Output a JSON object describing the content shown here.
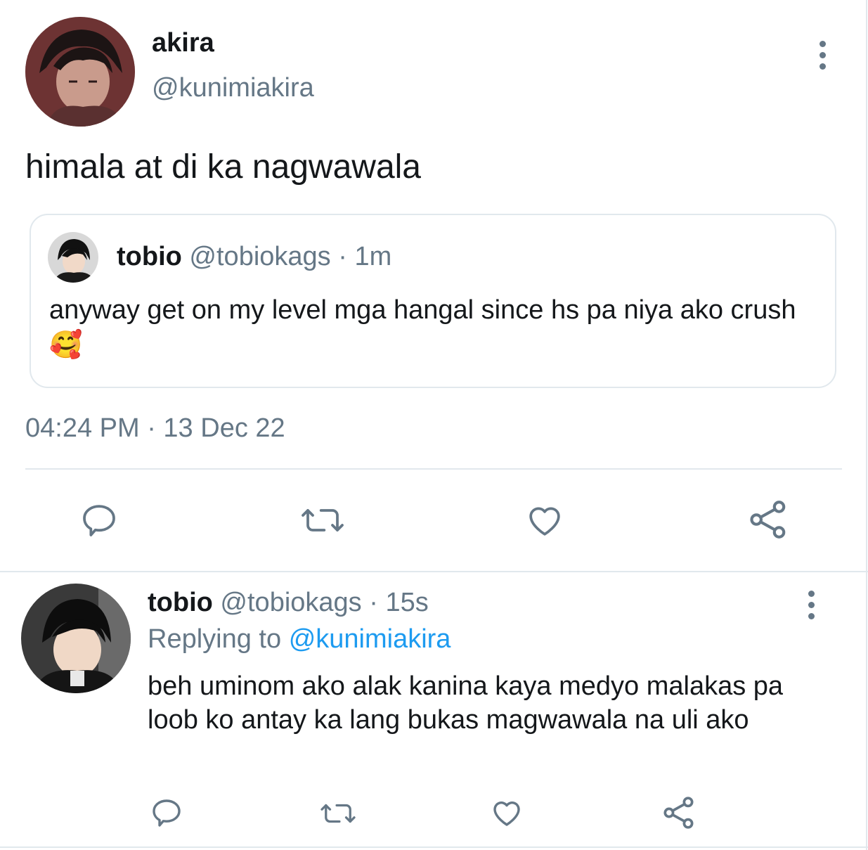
{
  "main_tweet": {
    "author_name": "akira",
    "author_handle": "@kunimiakira",
    "text": "himala at di ka nagwawala",
    "quoted": {
      "author_name": "tobio",
      "author_handle": "@tobiokags",
      "time": "· 1m",
      "text": "anyway get on my level mga hangal since hs pa niya ako crush",
      "emoji": "🥰"
    },
    "timestamp": "04:24 PM · 13 Dec 22"
  },
  "reply": {
    "author_name": "tobio",
    "author_handle": "@tobiokags",
    "time": "· 15s",
    "replying_prefix": "Replying to",
    "replying_handle": "@kunimiakira",
    "text": "beh uminom ako alak kanina kaya medyo malakas pa loob ko antay ka lang bukas magwawala na uli ako"
  },
  "colors": {
    "text": "#14171a",
    "muted": "#657786",
    "link": "#1d9bf0",
    "divider": "#e1e8ed"
  },
  "icons": [
    "more-icon",
    "reply-icon",
    "retweet-icon",
    "like-icon",
    "share-icon"
  ]
}
